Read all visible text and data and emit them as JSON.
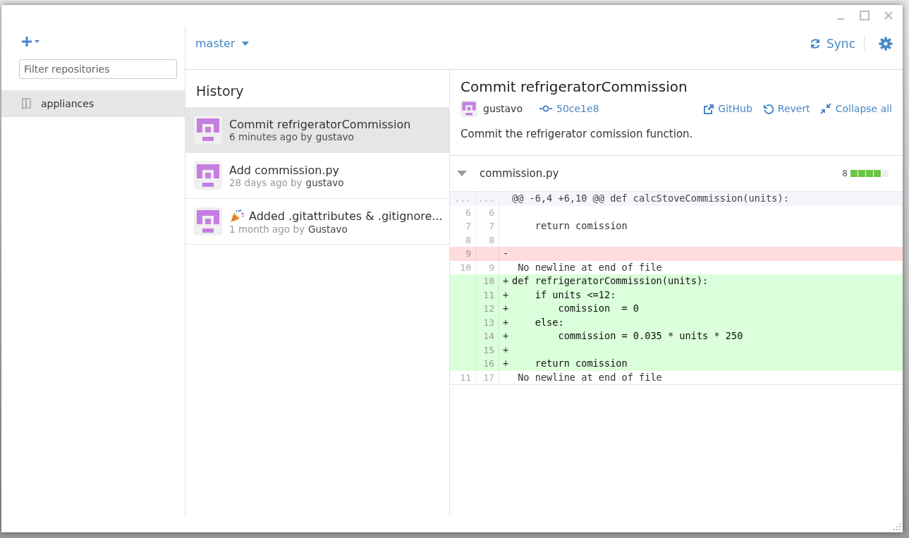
{
  "sidebar": {
    "filter": {
      "placeholder": "Filter repositories"
    },
    "repositories": [
      {
        "name": "appliances",
        "selected": true
      }
    ]
  },
  "toolbar": {
    "branch": "master",
    "sync": "Sync"
  },
  "history": {
    "title": "History",
    "commits": [
      {
        "kind": "plain",
        "title": "Commit refrigeratorCommission",
        "time": "6 minutes ago by",
        "author": "gustavo",
        "selected": true
      },
      {
        "kind": "plain",
        "title": "Add commission.py",
        "time": "28 days ago by",
        "author": "gustavo",
        "selected": false
      },
      {
        "kind": "emoji",
        "title": "Added .gitattributes & .gitignore...",
        "time": "1 month ago by",
        "author": "Gustavo",
        "selected": false
      }
    ]
  },
  "commit": {
    "title": "Commit refrigeratorCommission",
    "author": "gustavo",
    "sha": "50ce1e8",
    "actions": [
      "GitHub",
      "Revert",
      "Collapse all"
    ],
    "description": "Commit the refrigerator comission function."
  },
  "file": {
    "name": "commission.py",
    "expanded": true,
    "changes": "8",
    "level": 0.8,
    "lines": [
      {
        "kind": "hunk",
        "old": "...",
        "new": "...",
        "text": "@@ -6,4 +6,10 @@ def calcStoveCommission(units):"
      },
      {
        "kind": "context",
        "old": "6",
        "new": "6"
      },
      {
        "kind": "context",
        "old": "7",
        "new": "7",
        "text": "    return comission"
      },
      {
        "kind": "context",
        "old": "8",
        "new": "8"
      },
      {
        "kind": "deleted",
        "old": "9",
        "marker": "-"
      },
      {
        "kind": "context",
        "old": "10",
        "new": "9",
        "text": " No newline at end of file"
      },
      {
        "kind": "added",
        "new": "10",
        "marker": "+",
        "text": "def refrigeratorCommission(units):"
      },
      {
        "kind": "added",
        "new": "11",
        "marker": "+",
        "text": "    if units <=12:"
      },
      {
        "kind": "added",
        "new": "12",
        "marker": "+",
        "text": "        comission  = 0"
      },
      {
        "kind": "added",
        "new": "13",
        "marker": "+",
        "text": "    else:"
      },
      {
        "kind": "added",
        "new": "14",
        "marker": "+",
        "text": "        commission = 0.035 * units * 250"
      },
      {
        "kind": "added",
        "new": "15",
        "marker": "+"
      },
      {
        "kind": "added",
        "new": "16",
        "marker": "+",
        "text": "    return comission"
      },
      {
        "kind": "context",
        "old": "11",
        "new": "17",
        "text": " No newline at end of file"
      }
    ]
  }
}
